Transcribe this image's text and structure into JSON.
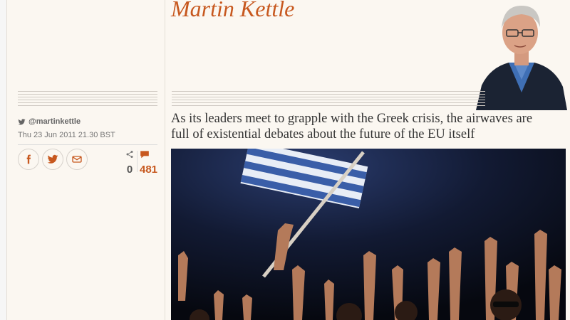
{
  "author": {
    "name": "Martin Kettle",
    "twitter_handle": "@martinkettle"
  },
  "article": {
    "date": "Thu 23 Jun 2011 21.30 BST",
    "standfirst": "As its leaders meet to grapple with the Greek crisis, the airwaves are full of existential debates about the future of the EU itself"
  },
  "share": {
    "buttons": [
      {
        "icon": "facebook-icon"
      },
      {
        "icon": "twitter-icon"
      },
      {
        "icon": "email-icon"
      }
    ],
    "share_count": "0",
    "comment_count": "481"
  },
  "colors": {
    "accent": "#c7581f",
    "background": "#fbf7f1"
  }
}
